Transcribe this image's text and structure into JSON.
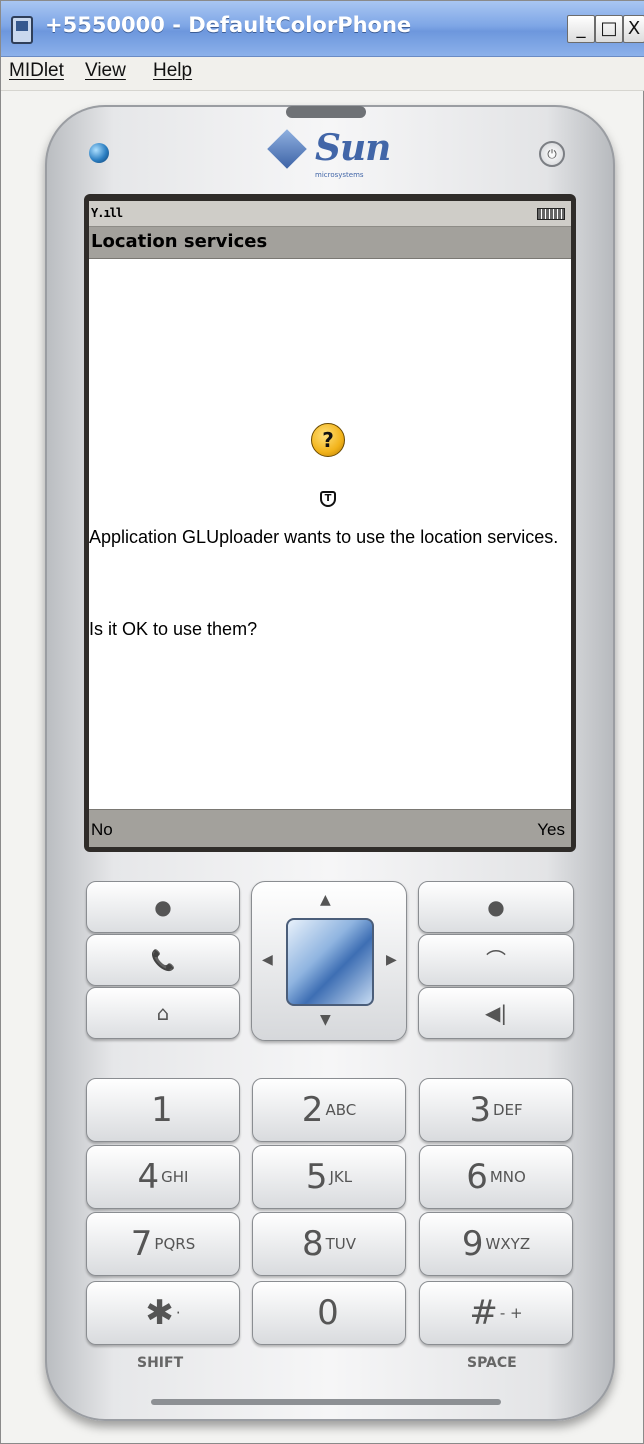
{
  "window": {
    "title": "+5550000 - DefaultColorPhone",
    "controls": {
      "minimize": "_",
      "maximize": "□",
      "close": "X"
    }
  },
  "menu": {
    "items": [
      "MIDlet",
      "View",
      "Help"
    ]
  },
  "brand": {
    "name": "Sun",
    "subtitle": "microsystems",
    "power_symbol": "⏻"
  },
  "screen": {
    "status": {
      "signal": "Y.ıll"
    },
    "title": "Location services",
    "message": "Application GLUploader wants to use the location services.",
    "question": "Is it OK to use them?",
    "question_icon": "?",
    "trust_icon": "T",
    "softkeys": {
      "left": "No",
      "right": "Yes"
    }
  },
  "nav_keys": {
    "soft_left": "●",
    "soft_right": "●",
    "call": "📞",
    "end": "⌒",
    "home": "⌂",
    "clear": "◀|",
    "up": "▲",
    "down": "▼",
    "left": "◀",
    "right": "▶"
  },
  "keypad": [
    {
      "digit": "1",
      "letters": ""
    },
    {
      "digit": "2",
      "letters": "ABC"
    },
    {
      "digit": "3",
      "letters": "DEF"
    },
    {
      "digit": "4",
      "letters": "GHI"
    },
    {
      "digit": "5",
      "letters": "JKL"
    },
    {
      "digit": "6",
      "letters": "MNO"
    },
    {
      "digit": "7",
      "letters": "PQRS"
    },
    {
      "digit": "8",
      "letters": "TUV"
    },
    {
      "digit": "9",
      "letters": "WXYZ"
    },
    {
      "digit": "✱",
      "letters": "·"
    },
    {
      "digit": "0",
      "letters": ""
    },
    {
      "digit": "#",
      "letters": "- +"
    }
  ],
  "key_labels": {
    "shift": "SHIFT",
    "space": "SPACE"
  }
}
